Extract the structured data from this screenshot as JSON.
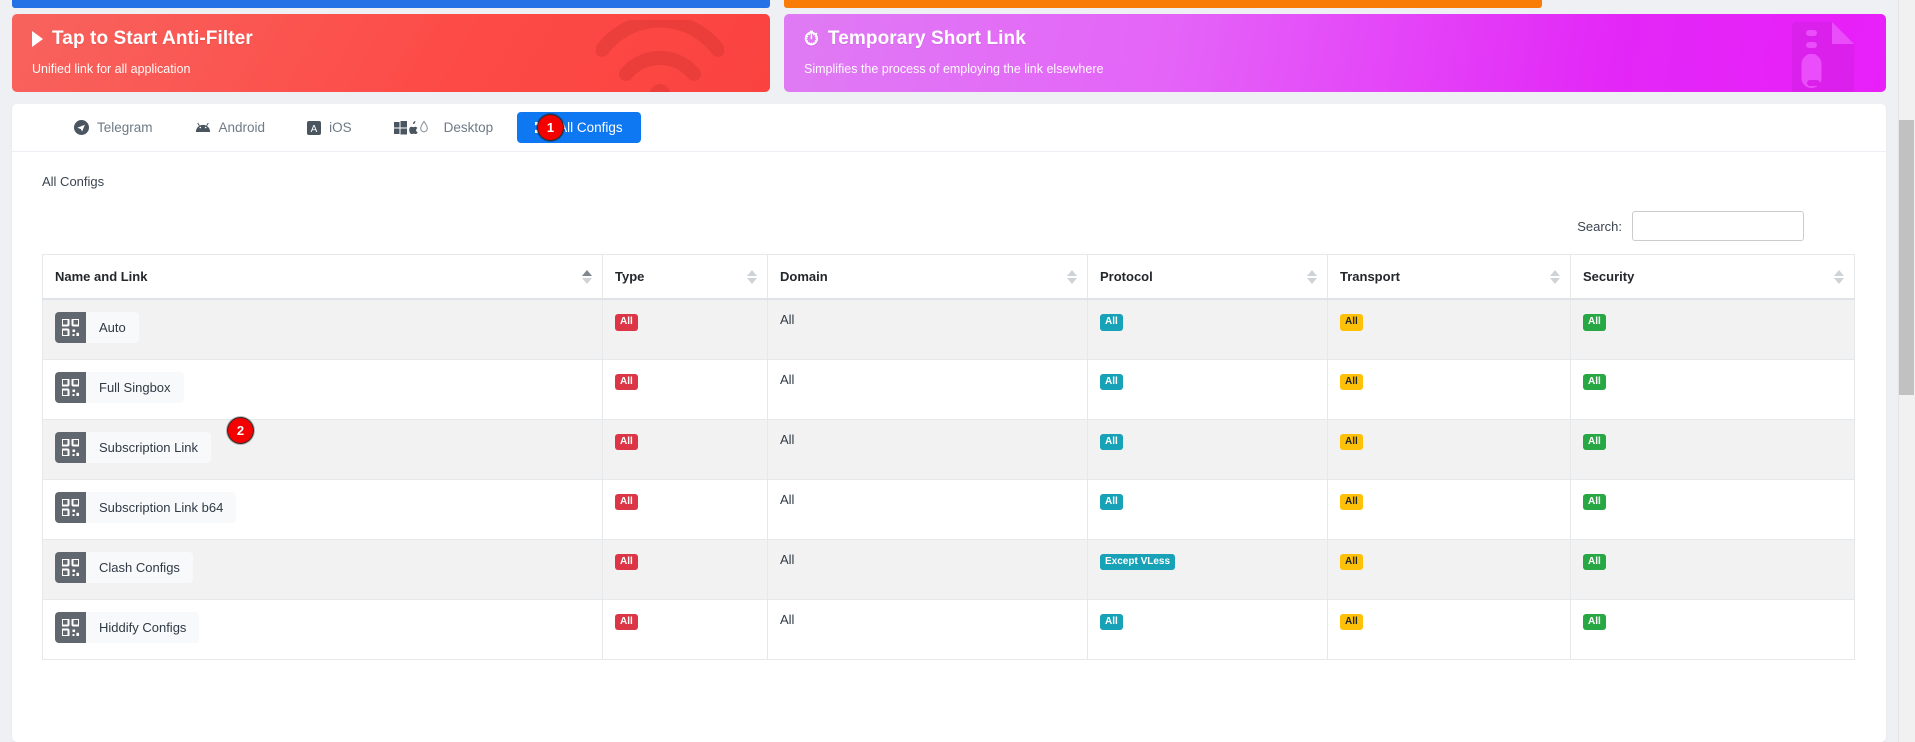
{
  "strips": {
    "left_color": "#2571e6",
    "right_color": "#f97c07"
  },
  "cards": [
    {
      "id": "anti-filter",
      "icon": "play-icon",
      "title": "Tap to Start Anti-Filter",
      "subtitle": "Unified link for all application",
      "art": "wifi-icon",
      "color": "#fd4a46"
    },
    {
      "id": "temporary-short-link",
      "icon": "stopwatch-icon",
      "icon_glyph": "⏱",
      "title": "Temporary Short Link",
      "subtitle": "Simplifies the process of employing the link elsewhere",
      "art": "file-zip-icon",
      "color": "#e327f7"
    }
  ],
  "tabs": [
    {
      "label": "Telegram",
      "icon": "telegram-icon",
      "active": false
    },
    {
      "label": "Android",
      "icon": "android-icon",
      "active": false
    },
    {
      "label": "iOS",
      "icon": "apple-ios-icon",
      "active": false
    },
    {
      "label": "Desktop",
      "icon": "desktop-platforms-icon",
      "active": false
    },
    {
      "label": "All Configs",
      "icon": "grid-icon",
      "active": true
    }
  ],
  "markers": [
    {
      "label": "1"
    },
    {
      "label": "2"
    }
  ],
  "content": {
    "breadcrumb": "All Configs",
    "search_label": "Search:",
    "search_value": "",
    "search_placeholder": ""
  },
  "table": {
    "columns": [
      {
        "label": "Name and Link",
        "sort": "asc"
      },
      {
        "label": "Type",
        "sort": "none"
      },
      {
        "label": "Domain",
        "sort": "none"
      },
      {
        "label": "Protocol",
        "sort": "none"
      },
      {
        "label": "Transport",
        "sort": "none"
      },
      {
        "label": "Security",
        "sort": "none"
      }
    ],
    "rows": [
      {
        "name": "Auto",
        "type": "All",
        "domain": "All",
        "protocol": "All",
        "transport": "All",
        "security": "All"
      },
      {
        "name": "Full Singbox",
        "type": "All",
        "domain": "All",
        "protocol": "All",
        "transport": "All",
        "security": "All"
      },
      {
        "name": "Subscription Link",
        "type": "All",
        "domain": "All",
        "protocol": "All",
        "transport": "All",
        "security": "All"
      },
      {
        "name": "Subscription Link b64",
        "type": "All",
        "domain": "All",
        "protocol": "All",
        "transport": "All",
        "security": "All"
      },
      {
        "name": "Clash Configs",
        "type": "All",
        "domain": "All",
        "protocol": "Except VLess",
        "transport": "All",
        "security": "All"
      },
      {
        "name": "Hiddify Configs",
        "type": "All",
        "domain": "All",
        "protocol": "All",
        "transport": "All",
        "security": "All"
      }
    ],
    "badge_colors": {
      "type": "#dc3545",
      "protocol": "#17a2b8",
      "transport": "#ffc107",
      "security": "#28a745"
    }
  }
}
